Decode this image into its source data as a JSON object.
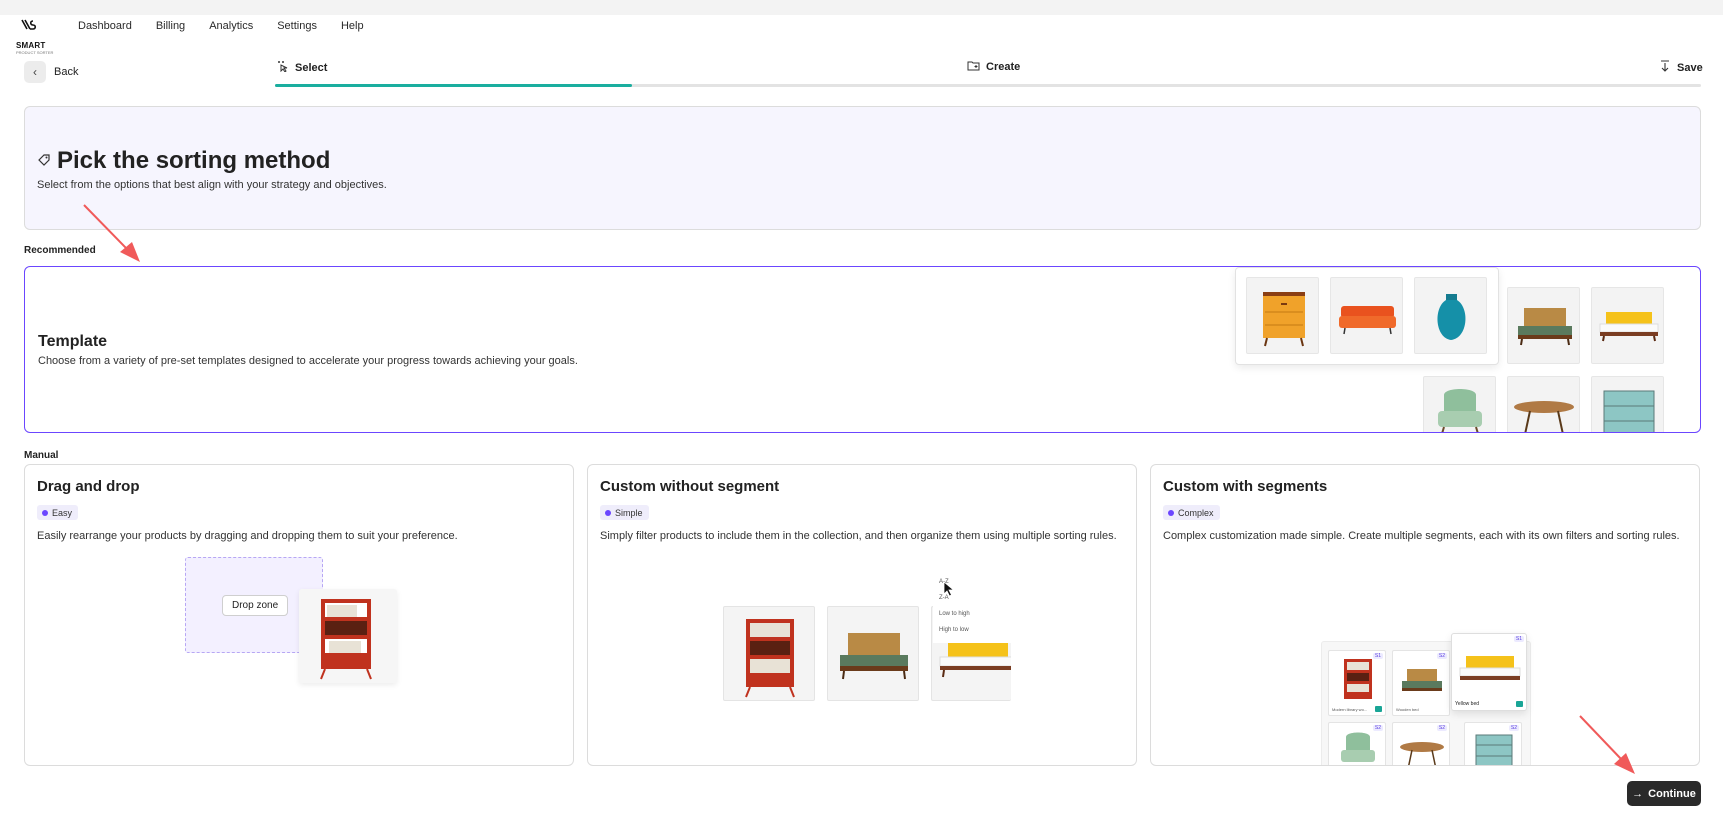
{
  "brand": {
    "name": "SMART",
    "tagline": "PRODUCT SORTER"
  },
  "nav": {
    "items": [
      "Dashboard",
      "Billing",
      "Analytics",
      "Settings",
      "Help"
    ]
  },
  "back": {
    "label": "Back",
    "icon": "chevron-left-icon"
  },
  "steps": [
    {
      "label": "Select",
      "icon": "sparkle-cursor-icon",
      "active": true
    },
    {
      "label": "Create",
      "icon": "folder-plus-icon",
      "active": false
    },
    {
      "label": "Save",
      "icon": "download-icon",
      "active": false
    }
  ],
  "progress": {
    "fraction": 0.25,
    "color": "#1aae9f"
  },
  "hero": {
    "icon": "tag-icon",
    "title": "Pick the sorting method",
    "subtitle": "Select from the options that best align with your strategy and objectives."
  },
  "sections": {
    "recommended": "Recommended",
    "manual": "Manual"
  },
  "template": {
    "title": "Template",
    "description": "Choose from a variety of pre-set templates designed to accelerate your progress towards achieving your goals."
  },
  "cards": [
    {
      "title": "Drag and drop",
      "badge": "Easy",
      "description": "Easily rearrange your products by dragging and dropping them to suit your preference.",
      "drop_zone_label": "Drop zone"
    },
    {
      "title": "Custom without segment",
      "badge": "Simple",
      "description": "Simply filter products to include them in the collection, and then organize them using multiple sorting rules.",
      "sort_options": [
        "A-Z",
        "Z-A",
        "Low to high",
        "High to low"
      ]
    },
    {
      "title": "Custom with segments",
      "badge": "Complex",
      "description": "Complex customization made simple. Create multiple segments, each with its own filters and sorting rules.",
      "segment_items": [
        {
          "tag": "S1",
          "label": "Modern library wo..."
        },
        {
          "tag": "S2",
          "label": "Wooden bed"
        }
      ],
      "front_item": {
        "tag": "S1",
        "label": "Yellow bed"
      },
      "segment_row2_tags": [
        "S2",
        "S2",
        "S2"
      ]
    }
  ],
  "continue": {
    "label": "Continue",
    "icon": "arrow-right-icon"
  },
  "colors": {
    "accent": "#6b46ff",
    "teal": "#1aae9f",
    "annotation": "#f05a5a"
  }
}
